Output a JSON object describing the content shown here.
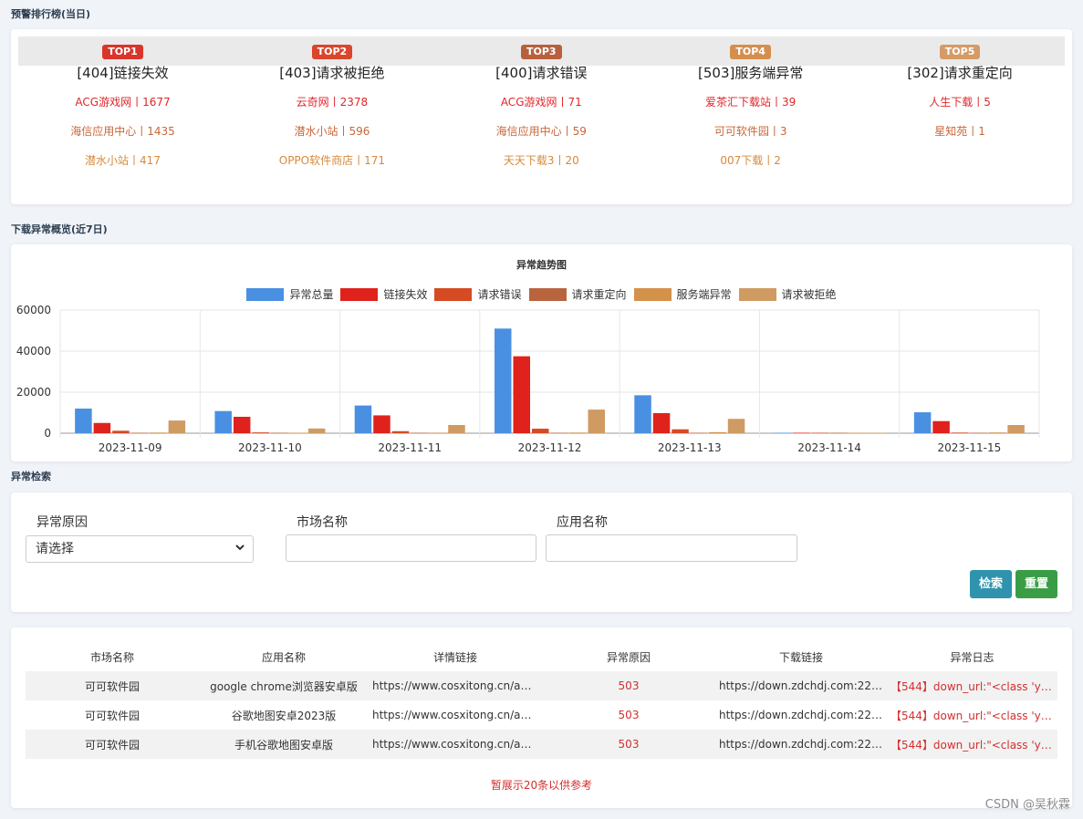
{
  "ranking": {
    "section_title": "预警排行榜(当日)",
    "columns": [
      {
        "badge": "TOP1",
        "badge_color": "#d9352b",
        "title": "[404]链接失效",
        "items": [
          {
            "text": "ACG游戏网丨1677",
            "color": "#e0262a"
          },
          {
            "text": "海信应用中心丨1435",
            "color": "#c8673a"
          },
          {
            "text": "潜水小站丨417",
            "color": "#d68a3c"
          }
        ]
      },
      {
        "badge": "TOP2",
        "badge_color": "#d9462b",
        "title": "[403]请求被拒绝",
        "items": [
          {
            "text": "云奇网丨2378",
            "color": "#e0262a"
          },
          {
            "text": "潜水小站丨596",
            "color": "#c8673a"
          },
          {
            "text": "OPPO软件商店丨171",
            "color": "#d68a3c"
          }
        ]
      },
      {
        "badge": "TOP3",
        "badge_color": "#b8603e",
        "title": "[400]请求错误",
        "items": [
          {
            "text": "ACG游戏网丨71",
            "color": "#e0262a"
          },
          {
            "text": "海信应用中心丨59",
            "color": "#c8673a"
          },
          {
            "text": "天天下载3丨20",
            "color": "#d68a3c"
          }
        ]
      },
      {
        "badge": "TOP4",
        "badge_color": "#d48f4c",
        "title": "[503]服务端异常",
        "items": [
          {
            "text": "爱茶汇下载站丨39",
            "color": "#e0262a"
          },
          {
            "text": "可可软件园丨3",
            "color": "#c8673a"
          },
          {
            "text": "007下载丨2",
            "color": "#d68a3c"
          }
        ]
      },
      {
        "badge": "TOP5",
        "badge_color": "#d59b66",
        "title": "[302]请求重定向",
        "items": [
          {
            "text": "人生下载丨5",
            "color": "#e0262a"
          },
          {
            "text": "星知苑丨1",
            "color": "#c8673a"
          }
        ]
      }
    ]
  },
  "overview": {
    "section_title": "下载异常概览(近7日)"
  },
  "chart_data": {
    "type": "bar",
    "title": "异常趋势图",
    "xlabel": "",
    "ylabel": "",
    "ylim": [
      0,
      60000
    ],
    "yticks": [
      0,
      20000,
      40000,
      60000
    ],
    "grid": true,
    "legend_position": "top",
    "categories": [
      "2023-11-09",
      "2023-11-10",
      "2023-11-11",
      "2023-11-12",
      "2023-11-13",
      "2023-11-14",
      "2023-11-15"
    ],
    "series": [
      {
        "name": "异常总量",
        "color": "#4a90e2",
        "values": [
          12000,
          10800,
          13500,
          51000,
          18500,
          150,
          10200
        ]
      },
      {
        "name": "链接失效",
        "color": "#e0221c",
        "values": [
          5000,
          8000,
          8700,
          37500,
          9800,
          60,
          5900
        ]
      },
      {
        "name": "请求错误",
        "color": "#d64a24",
        "values": [
          1200,
          400,
          1000,
          2200,
          1900,
          40,
          300
        ]
      },
      {
        "name": "请求重定向",
        "color": "#b8643e",
        "values": [
          50,
          30,
          40,
          60,
          50,
          10,
          40
        ]
      },
      {
        "name": "服务端异常",
        "color": "#d4914a",
        "values": [
          300,
          200,
          250,
          300,
          500,
          20,
          350
        ]
      },
      {
        "name": "请求被拒绝",
        "color": "#cf9b63",
        "values": [
          6200,
          2300,
          4000,
          11500,
          7000,
          60,
          4000
        ]
      }
    ]
  },
  "search": {
    "section_title": "异常检索",
    "reason_label": "异常原因",
    "reason_value": "请选择",
    "market_label": "市场名称",
    "market_value": "",
    "app_label": "应用名称",
    "app_value": "",
    "search_button": "检索",
    "reset_button": "重置"
  },
  "table": {
    "headers": [
      "市场名称",
      "应用名称",
      "详情链接",
      "异常原因",
      "下载链接",
      "异常日志"
    ],
    "rows": [
      [
        "可可软件园",
        "google chrome浏览器安卓版",
        "https://www.cosxitong.cn/an…",
        "503",
        "https://down.zdchdj.com:223…",
        "【544】down_url:\"<class 'yo…"
      ],
      [
        "可可软件园",
        "谷歌地图安卓2023版",
        "https://www.cosxitong.cn/an…",
        "503",
        "https://down.zdchdj.com:223…",
        "【544】down_url:\"<class 'yo…"
      ],
      [
        "可可软件园",
        "手机谷歌地图安卓版",
        "https://www.cosxitong.cn/an…",
        "503",
        "https://down.zdchdj.com:223…",
        "【544】down_url:\"<class 'yo…"
      ]
    ],
    "note": "暂展示20条以供参考"
  },
  "watermark": "CSDN @吴秋霖"
}
